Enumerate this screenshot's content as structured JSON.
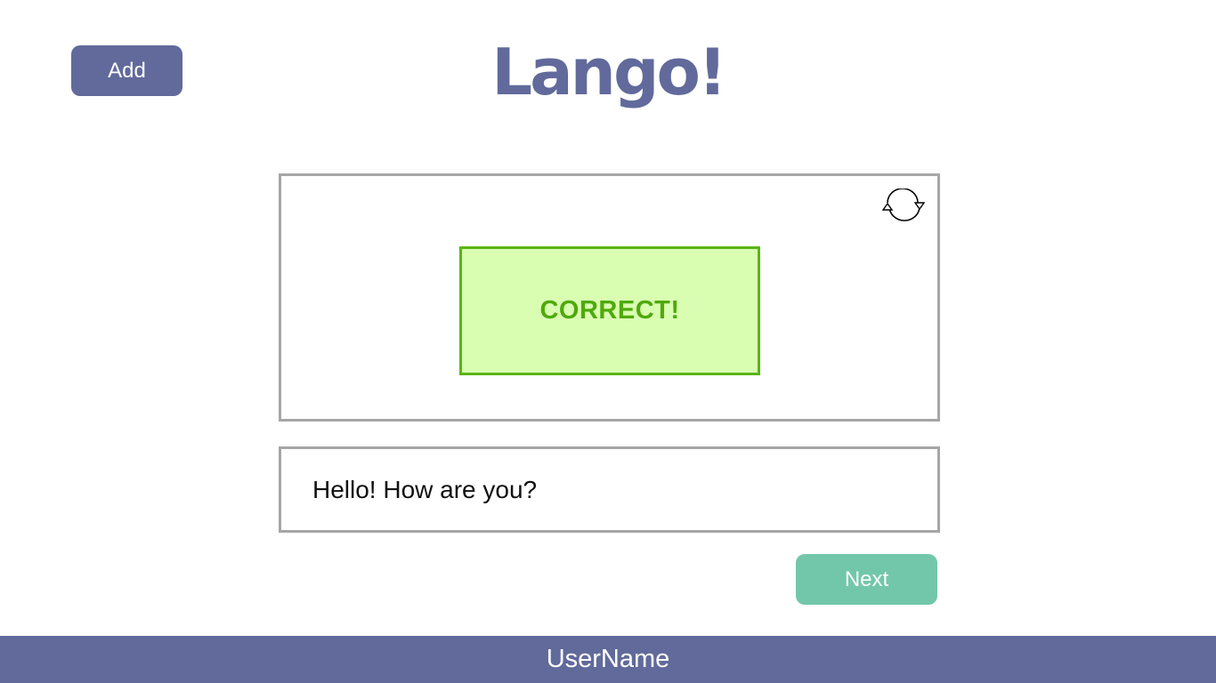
{
  "header": {
    "add_label": "Add",
    "title": "Lango!"
  },
  "card": {
    "flip_icon": "refresh-icon",
    "feedback_text": "CORRECT!"
  },
  "answer": {
    "value": "Hello! How are you?"
  },
  "actions": {
    "next_label": "Next"
  },
  "footer": {
    "username": "UserName"
  },
  "colors": {
    "brand": "#616a9b",
    "next": "#72c7aa",
    "correct_border": "#5ab515",
    "correct_fill": "#d9feb2",
    "correct_text": "#4fa90b",
    "border": "#a6a6a6"
  }
}
